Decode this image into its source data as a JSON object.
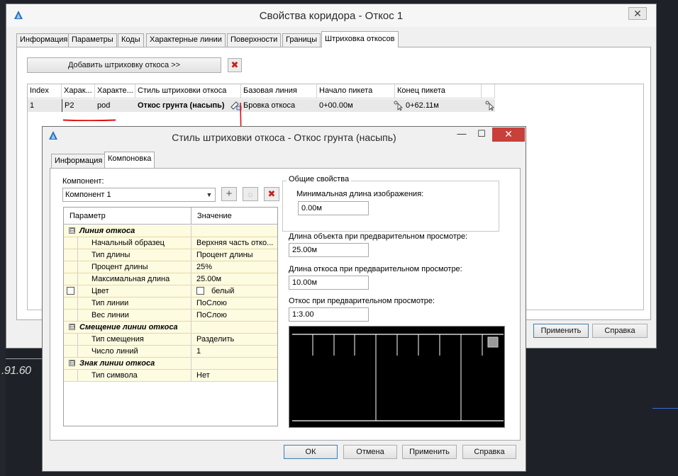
{
  "background": {
    "cad_label": ".91.60"
  },
  "win1": {
    "title": "Свойства коридора - Откос 1",
    "close_glyph": "✕",
    "tabs": [
      "Информация",
      "Параметры",
      "Коды",
      "Характерные линии",
      "Поверхности",
      "Границы",
      "Штриховка откосов"
    ],
    "active_tab": "Штриховка откосов",
    "add_hatch_label": "Добавить штриховку откоса >>",
    "table": {
      "columns": [
        "Index",
        "Харак...",
        "Характе...",
        "Стиль штриховки откоса",
        "Базовая линия",
        "Начало пикета",
        "Конец пикета"
      ],
      "rows": [
        {
          "index": "1",
          "char1": "P2",
          "char2": "pod",
          "style": "Откос грунта (насыпь)",
          "baseline": "Бровка откоса",
          "start": "0+00.00м",
          "end": "0+62.11м"
        }
      ]
    },
    "apply_label": "Применить",
    "help_label": "Справка"
  },
  "win2": {
    "title": "Стиль штриховки откоса - Откос грунта (насыпь)",
    "minimize_glyph": "—",
    "maximize_glyph": "☐",
    "close_glyph": "✕",
    "tabs": [
      "Информация",
      "Компоновка"
    ],
    "active_tab": "Компоновка",
    "component_label": "Компонент:",
    "component_value": "Компонент 1",
    "add_glyph": "+",
    "copy_glyph": "☼",
    "prop_header": {
      "name": "Параметр",
      "value": "Значение"
    },
    "props": [
      {
        "type": "cat",
        "name": "Линия откоса",
        "expander": "⊟"
      },
      {
        "type": "row",
        "name": "Начальный образец",
        "value": "Верхняя часть отко..."
      },
      {
        "type": "row",
        "name": "Тип длины",
        "value": "Процент длины"
      },
      {
        "type": "row",
        "name": "Процент длины",
        "value": "25%"
      },
      {
        "type": "row",
        "name": "Максимальная длина",
        "value": "25.00м"
      },
      {
        "type": "row",
        "name": "Цвет",
        "value": "белый",
        "color": "#ffffff"
      },
      {
        "type": "row",
        "name": "Тип линии",
        "value": "ПоСлою"
      },
      {
        "type": "row",
        "name": "Вес линии",
        "value": "ПоСлою"
      },
      {
        "type": "cat",
        "name": "Смещение линии откоса",
        "expander": "⊟"
      },
      {
        "type": "row",
        "name": "Тип смещения",
        "value": "Разделить"
      },
      {
        "type": "row",
        "name": "Число линий",
        "value": "1"
      },
      {
        "type": "cat",
        "name": "Знак линии откоса",
        "expander": "⊟"
      },
      {
        "type": "row",
        "name": "Тип символа",
        "value": "Нет"
      }
    ],
    "general_group_title": "Общие свойства",
    "min_image_length_label": "Минимальная длина изображения:",
    "min_image_length_value": "0.00м",
    "object_length_label": "Длина объекта при предварительном просмотре:",
    "object_length_value": "25.00м",
    "slope_length_label": "Длина откоса при предварительном просмотре:",
    "slope_length_value": "10.00м",
    "slope_ratio_label": "Откос при предварительном просмотре:",
    "slope_ratio_value": "1:3.00",
    "ok_label": "ОК",
    "cancel_label": "Отмена",
    "apply_label": "Применить",
    "help_label": "Справка"
  }
}
